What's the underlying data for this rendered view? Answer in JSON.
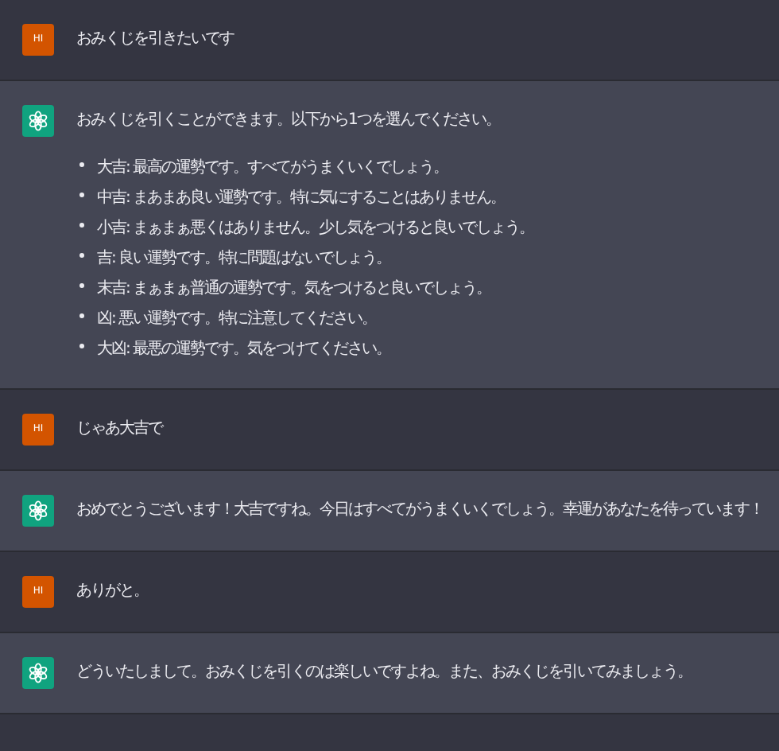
{
  "messages": [
    {
      "kind": "user",
      "avatar": "HI",
      "text": "おみくじを引きたいです"
    },
    {
      "kind": "assistant",
      "text": "おみくじを引くことができます。以下から1つを選んでください。",
      "list": [
        "大吉: 最高の運勢です。すべてがうまくいくでしょう。",
        "中吉: まあまあ良い運勢です。特に気にすることはありません。",
        "小吉: まぁまぁ悪くはありません。少し気をつけると良いでしょう。",
        "吉: 良い運勢です。特に問題はないでしょう。",
        "末吉: まぁまぁ普通の運勢です。気をつけると良いでしょう。",
        "凶: 悪い運勢です。特に注意してください。",
        "大凶: 最悪の運勢です。気をつけてください。"
      ]
    },
    {
      "kind": "user",
      "avatar": "HI",
      "text": "じゃあ大吉で"
    },
    {
      "kind": "assistant",
      "text": "おめでとうございます！大吉ですね。今日はすべてがうまくいくでしょう。幸運があなたを待っています！"
    },
    {
      "kind": "user",
      "avatar": "HI",
      "text": "ありがと。"
    },
    {
      "kind": "assistant",
      "text": "どういたしまして。おみくじを引くのは楽しいですよね。また、おみくじを引いてみましょう。"
    }
  ]
}
